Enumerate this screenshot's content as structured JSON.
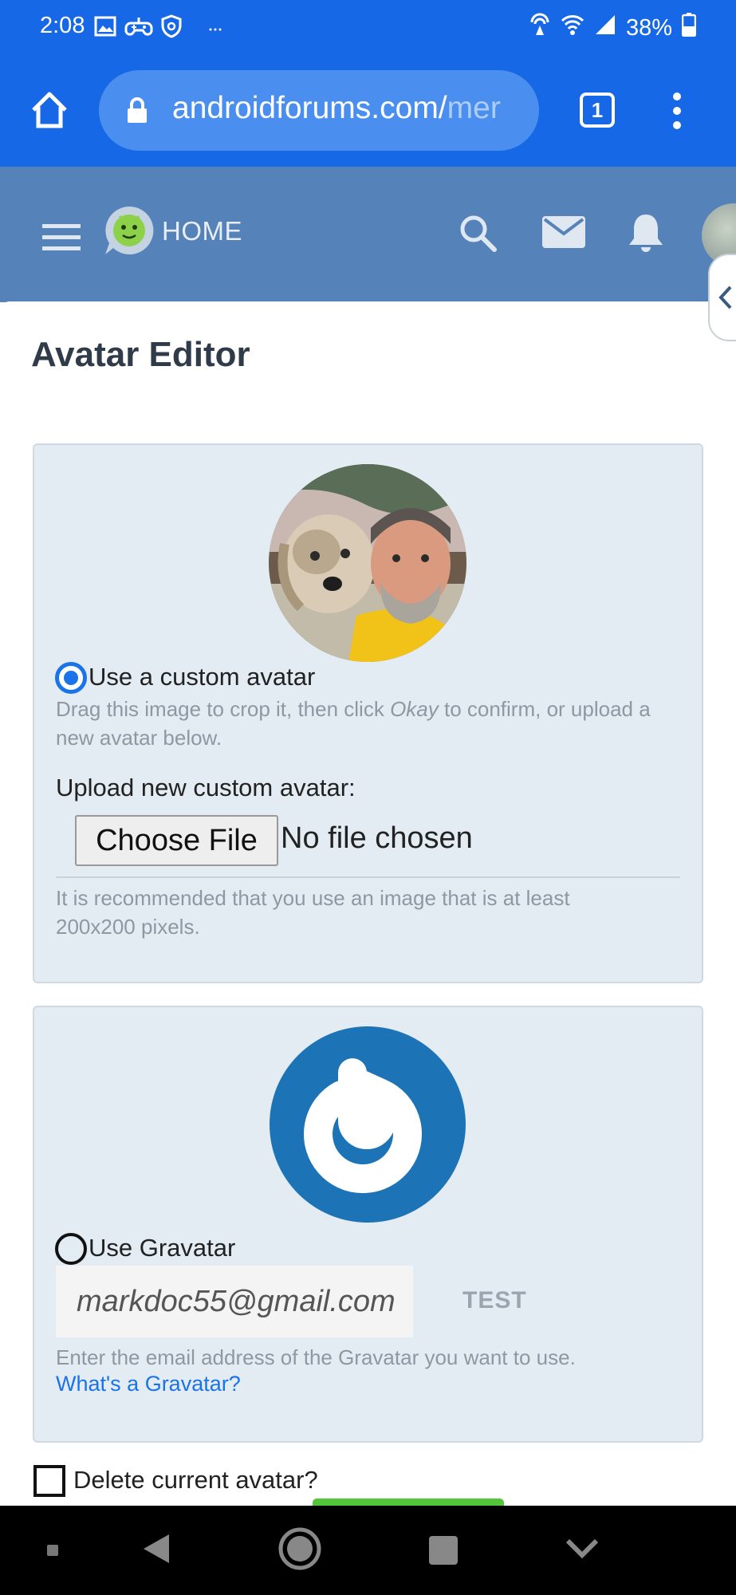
{
  "status_bar": {
    "time": "2:08",
    "battery": "38%",
    "icons": [
      "gallery-icon",
      "game-controller-icon",
      "shield-icon",
      "more-dots-icon",
      "hotspot-icon",
      "wifi-icon",
      "signal-icon",
      "battery-icon"
    ]
  },
  "browser": {
    "url_visible": "androidforums.com/",
    "url_faded": "mer",
    "tab_count": "1"
  },
  "forum_header": {
    "home_label": "HOME"
  },
  "page": {
    "title": "Avatar Editor"
  },
  "custom_avatar": {
    "option_label": "Use a custom avatar",
    "hint_before": "Drag this image to crop it, then click ",
    "hint_emphasis": "Okay",
    "hint_after": " to confirm, or upload a new avatar below.",
    "upload_label": "Upload new custom avatar:",
    "choose_button": "Choose File",
    "no_file": "No file chosen",
    "recommendation": "It is recommended that you use an image that is at least 200x200 pixels.",
    "selected": true
  },
  "gravatar": {
    "option_label": "Use Gravatar",
    "email_value": "markdoc55@gmail.com",
    "test_button": "TEST",
    "hint": "Enter the email address of the Gravatar you want to use.",
    "link": "What's a Gravatar?",
    "selected": false
  },
  "delete": {
    "label": "Delete current avatar?",
    "checked": false
  },
  "colors": {
    "browser_blue": "#1668e6",
    "forum_header": "#5482b9",
    "panel_bg": "#e3ebf3",
    "accent": "#1a73e8",
    "gravatar_blue": "#1c73b6",
    "save_green": "#53c53b"
  }
}
